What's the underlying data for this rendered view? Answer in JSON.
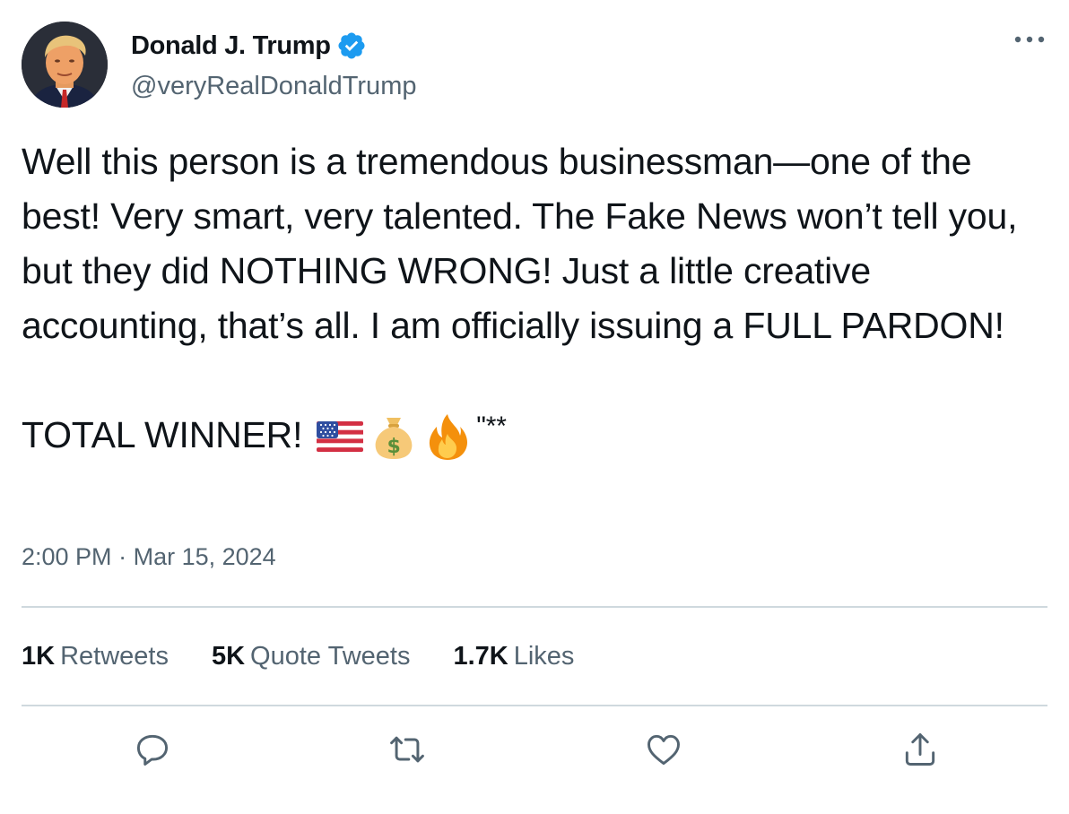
{
  "author": {
    "display_name": "Donald J. Trump",
    "handle": "@veryRealDonaldTrump",
    "verified": true,
    "verified_color": "#1d9bf0"
  },
  "tweet": {
    "text": "Well this person is a tremendous businessman—one of the best! Very smart, very talented. The Fake News won’t tell you, but they did NOTHING WRONG! Just a little creative accounting, that’s all. I am officially issuing a FULL PARDON!",
    "closing_text": "TOTAL WINNER!",
    "closing_emojis": [
      "us-flag-emoji",
      "money-bag-emoji",
      "fire-emoji"
    ],
    "closing_suffix": "\"**"
  },
  "meta": {
    "time": "2:00 PM",
    "separator": "·",
    "date": "Mar 15, 2024"
  },
  "stats": {
    "retweets": {
      "count": "1K",
      "label": "Retweets"
    },
    "quote_tweets": {
      "count": "5K",
      "label": "Quote Tweets"
    },
    "likes": {
      "count": "1.7K",
      "label": "Likes"
    }
  },
  "actions": [
    "reply-icon",
    "retweet-icon",
    "like-icon",
    "share-icon"
  ],
  "colors": {
    "text_primary": "#0f1419",
    "text_secondary": "#536471",
    "divider": "#cfd9de",
    "icon": "#536471"
  }
}
